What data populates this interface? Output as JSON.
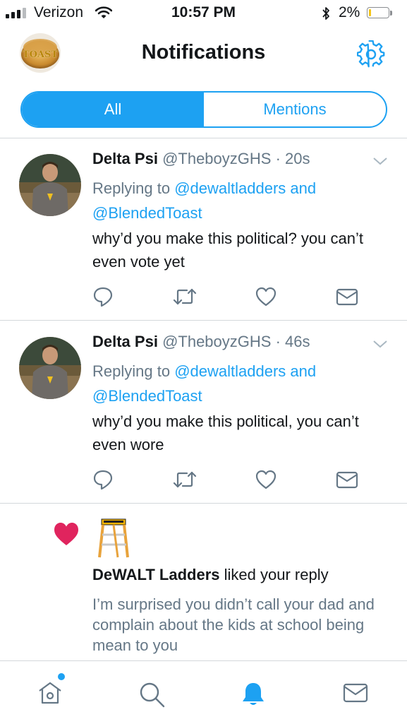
{
  "status_bar": {
    "carrier": "Verizon",
    "time": "10:57 PM",
    "battery": "2%"
  },
  "header": {
    "avatar_text": "TOAST",
    "title": "Notifications"
  },
  "tabs": {
    "all": "All",
    "mentions": "Mentions",
    "selected": "All"
  },
  "notifications": [
    {
      "name": "Delta Psi",
      "handle": "@TheboyzGHS",
      "time": "· 20s",
      "replying_prefix": "Replying to",
      "replying_to": "@dewaltladders and @BlendedToast",
      "text": "why’d you make this political? you can’t even vote yet"
    },
    {
      "name": "Delta Psi",
      "handle": "@TheboyzGHS",
      "time": "· 46s",
      "replying_prefix": "Replying to",
      "replying_to": "@dewaltladders and @BlendedToast",
      "text": "why’d you make this political, you can’t even wore"
    }
  ],
  "like_notification": {
    "user": "DeWALT Ladders",
    "action": "liked your reply",
    "text": "I’m surprised you didn’t call your dad and complain about the kids at school being mean to you"
  },
  "icons": {
    "header": [
      "gear-icon"
    ],
    "tweet_actions": [
      "reply-icon",
      "retweet-icon",
      "like-icon",
      "message-icon"
    ],
    "tabbar": [
      "home-icon",
      "search-icon",
      "notifications-icon",
      "messages-icon"
    ]
  },
  "colors": {
    "accent": "#1da1f2",
    "like": "#e0245e",
    "secondary_text": "#657786",
    "divider": "#d4d8db"
  }
}
